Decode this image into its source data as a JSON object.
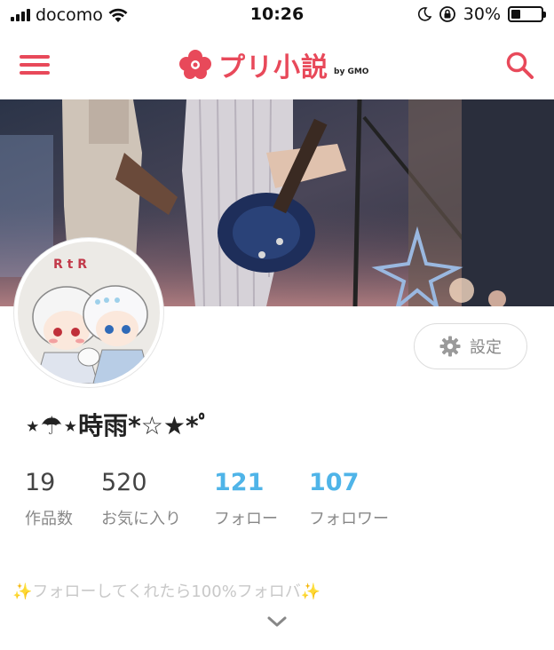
{
  "status_bar": {
    "carrier": "docomo",
    "time": "10:26",
    "battery_percent": "30%",
    "battery_level": 0.3
  },
  "header": {
    "logo_text": "プリ小説",
    "logo_sub": "by GMO",
    "brand_color": "#e8495a",
    "menu_icon": "hamburger-menu-icon",
    "search_icon": "search-icon"
  },
  "avatar": {
    "caption": "R t R"
  },
  "profile": {
    "settings_label": "設定",
    "username": "⋆☂︎⋆時雨*☆★*ﾟ",
    "stats": [
      {
        "value": "19",
        "label": "作品数"
      },
      {
        "value": "520",
        "label": "お気に入り"
      },
      {
        "value": "121",
        "label": "フォロー"
      },
      {
        "value": "107",
        "label": "フォロワー"
      }
    ],
    "bio_prefix": "✨",
    "bio_text": "フォローしてくれたら100%フォロバ",
    "bio_suffix": "✨",
    "accent_color": "#4fb4e8"
  }
}
